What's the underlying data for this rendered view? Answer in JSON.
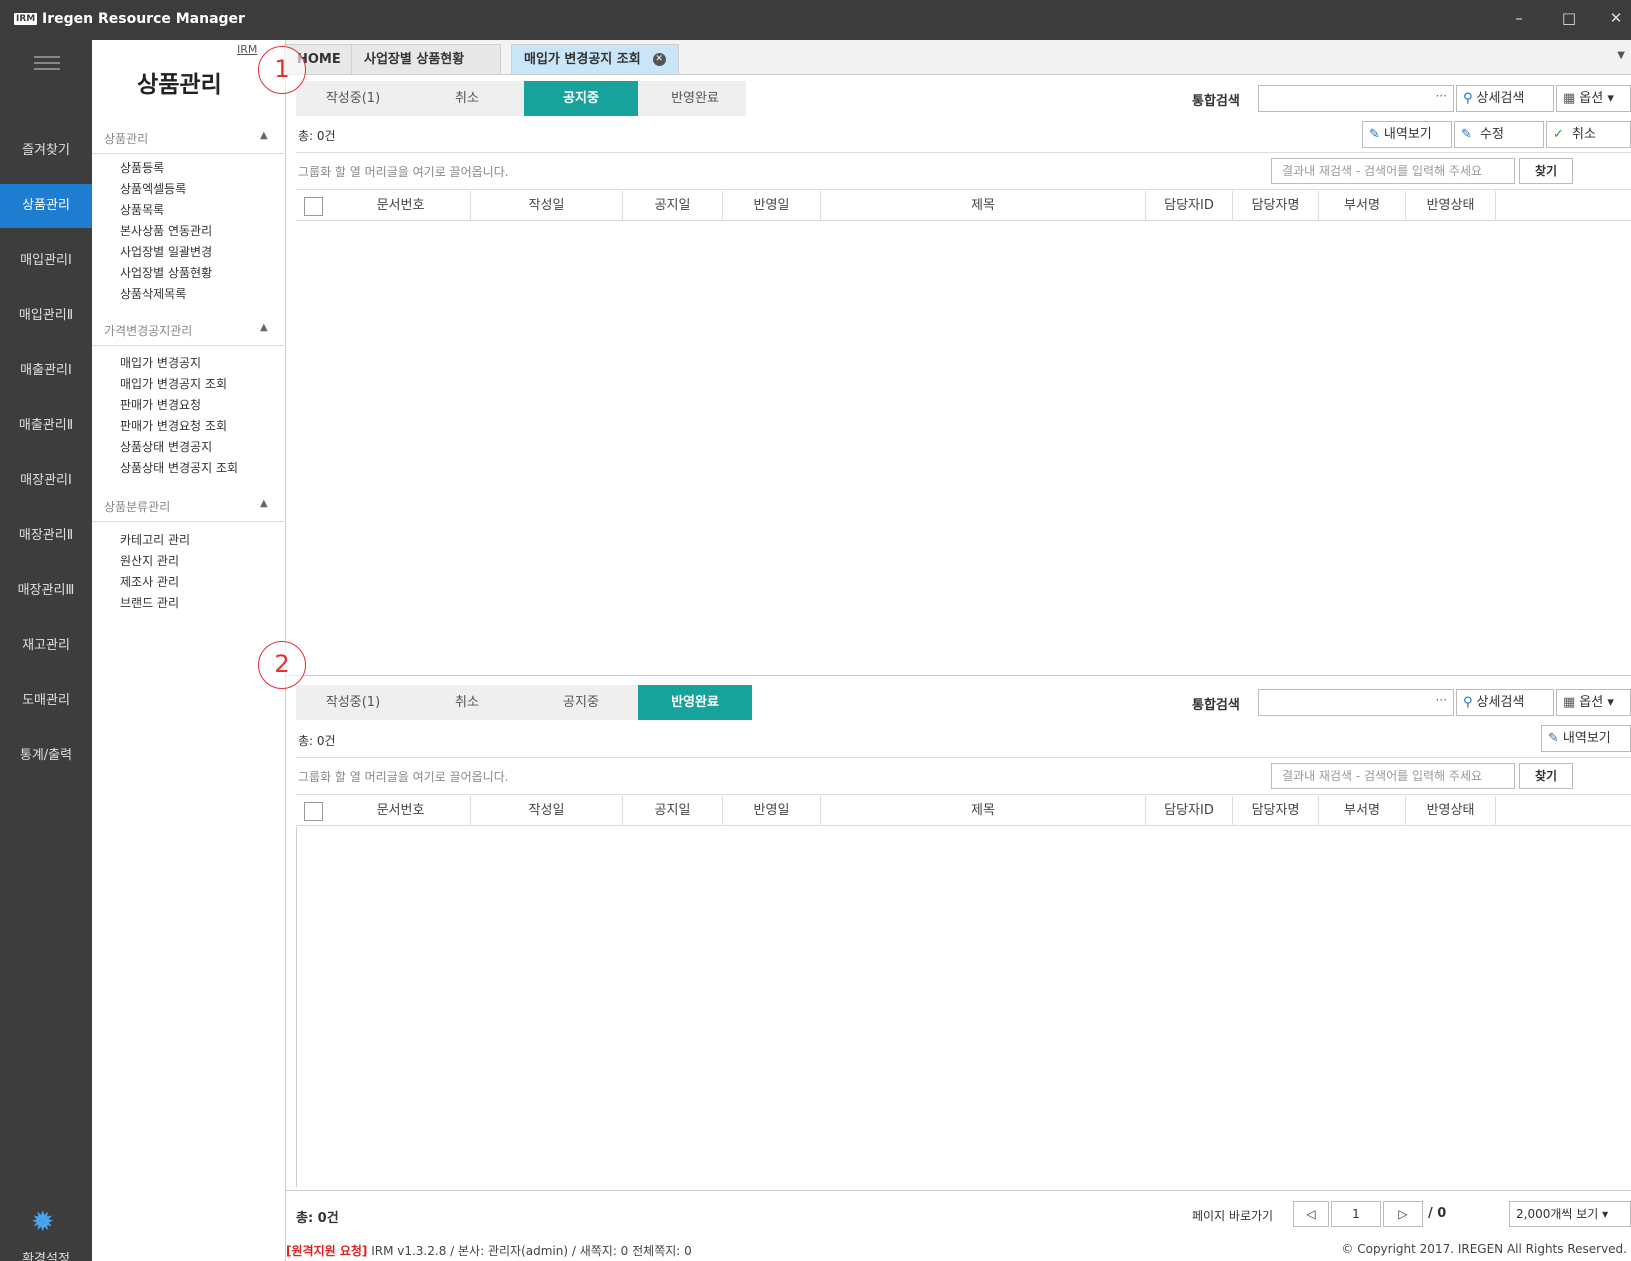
{
  "window": {
    "logo": "IRM",
    "title": "Iregen Resource Manager",
    "minimize": "–",
    "maximize": "□",
    "close": "✕"
  },
  "nav": {
    "items": [
      "즐겨찾기",
      "상품관리",
      "매입관리Ⅰ",
      "매입관리Ⅱ",
      "매출관리Ⅰ",
      "매출관리Ⅱ",
      "매장관리Ⅰ",
      "매장관리Ⅱ",
      "매장관리Ⅲ",
      "재고관리",
      "도매관리",
      "통계/출력"
    ],
    "settings_label": "환경설정"
  },
  "menu": {
    "irm_link": "IRM",
    "module_title": "상품관리",
    "groups": [
      {
        "title": "상품관리",
        "items": [
          "상품등록",
          "상품엑셀등록",
          "상품목록",
          "본사상품 연동관리",
          "사업장별 일괄변경",
          "사업장별 상품현황",
          "상품삭제목록"
        ]
      },
      {
        "title": "가격변경공지관리",
        "items": [
          "매입가 변경공지",
          "매입가 변경공지 조회",
          "판매가 변경요청",
          "판매가 변경요청 조회",
          "상품상태 변경공지",
          "상품상태 변경공지 조회"
        ]
      },
      {
        "title": "상품분류관리",
        "items": [
          "카테고리 관리",
          "원산지 관리",
          "제조사 관리",
          "브랜드 관리"
        ]
      }
    ]
  },
  "doc_tabs": [
    "HOME",
    "사업장별 상품현황",
    "매입가 변경공지 조회"
  ],
  "status_tabs": [
    "작성중(1)",
    "취소",
    "공지중",
    "반영완료"
  ],
  "search": {
    "label": "통합검색",
    "dots": "···",
    "detail": "상세검색",
    "options": "옵션"
  },
  "actions": {
    "history": "내역보기",
    "edit": "수정",
    "cancel": "취소"
  },
  "grid": {
    "count": "총: 0건",
    "group_hint": "그룹화 할 열 머리글을 여기로 끌어옵니다.",
    "filter_placeholder": "결과내 재검색 - 검색어를 입력해 주세요",
    "find": "찾기",
    "columns": [
      "문서번호",
      "작성일",
      "공지일",
      "반영일",
      "제목",
      "담당자ID",
      "담당자명",
      "부서명",
      "반영상태"
    ]
  },
  "badges": [
    "1",
    "2"
  ],
  "footer": {
    "total": "총: 0건",
    "page_jump": "페이지 바로가기",
    "prev": "◁",
    "page": "1",
    "next": "▷",
    "page_total": "/ 0",
    "page_size": "2,000개씩 보기"
  },
  "statusline": {
    "remote": "[원격지원 요청]",
    "info": " IRM v1.3.2.8 / 본사: 관리자(admin) / 새쪽지: 0 전체쪽지: 0",
    "copyright": "© Copyright 2017. IREGEN All Rights Reserved."
  },
  "colors": {
    "accent": "#17a39b",
    "nav_active": "#1e7dd0",
    "badge": "#e03030"
  }
}
